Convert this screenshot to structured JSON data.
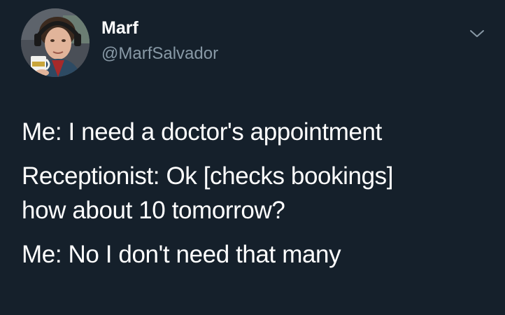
{
  "colors": {
    "background": "#15202b",
    "text_primary": "#ffffff",
    "text_secondary": "#8899a6"
  },
  "author": {
    "display_name": "Marf",
    "handle": "@MarfSalvador",
    "avatar_icon": "profile-photo"
  },
  "menu": {
    "icon": "chevron-down-icon"
  },
  "tweet": {
    "lines": [
      "Me: I need a doctor's appointment",
      "Receptionist: Ok [checks bookings]",
      "how about 10 tomorrow?",
      "Me: No I don't need that many"
    ]
  }
}
